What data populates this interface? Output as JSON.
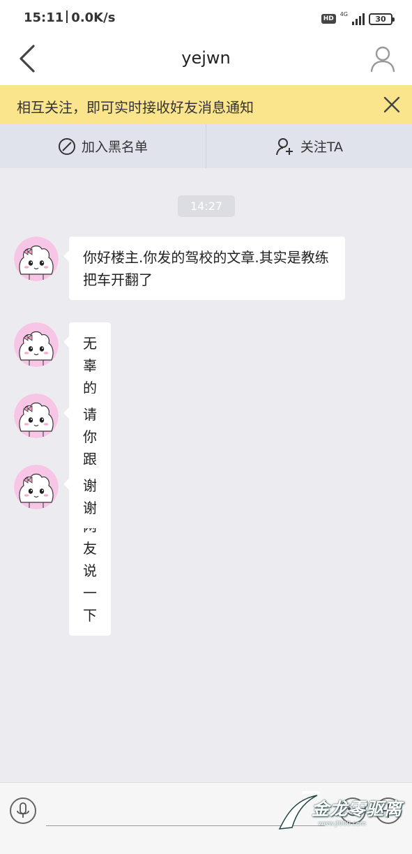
{
  "status_bar": {
    "time": "15:11",
    "net_speed": "0.0K/s",
    "hd_badge": "HD",
    "network_type": "4G",
    "battery": "30"
  },
  "nav": {
    "title": "yejwn",
    "back_icon": "chevron-left-icon",
    "profile_icon": "user-icon"
  },
  "notice": {
    "text": "相互关注，即可实时接收好友消息通知",
    "close_icon": "close-icon"
  },
  "actions": {
    "block_label": "加入黑名单",
    "follow_label": "关注TA"
  },
  "chat": {
    "time_stamp": "14:27",
    "messages": [
      {
        "text": "你好楼主.你发的驾校的文章.其实是教练把车开翻了"
      },
      {
        "text": "无辜的是学员"
      },
      {
        "text": "请你跟广大网友说一下"
      },
      {
        "text": "谢谢"
      }
    ]
  },
  "input_bar": {
    "placeholder": "",
    "voice_icon": "microphone-icon",
    "emoji_icon": "smiley-icon",
    "more_icon": "plus-icon"
  },
  "watermark": {
    "text": "金龙零驱离",
    "url": "www.jl000.com"
  }
}
